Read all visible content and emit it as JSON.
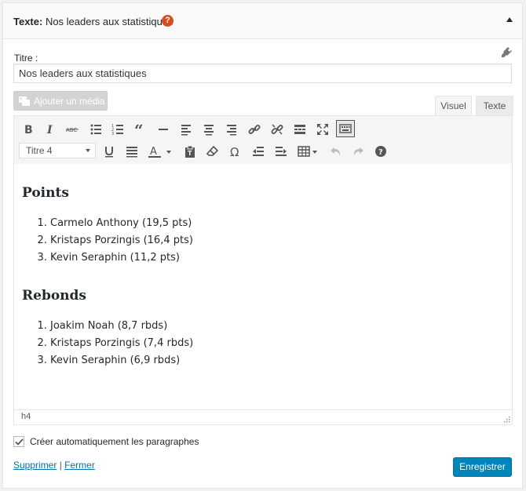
{
  "widget": {
    "title_prefix": "Texte:",
    "title_value": " Nos leaders aux statistiques",
    "help_label": "?"
  },
  "form": {
    "title_label": "Titre :",
    "title_value": "Nos leaders aux statistiques"
  },
  "editor": {
    "media_button_label": "Ajouter un média",
    "tabs": [
      {
        "label": "Visuel",
        "active": true
      },
      {
        "label": "Texte",
        "active": false
      }
    ],
    "toolbar_row1": [
      "bold-icon",
      "italic-icon",
      "strikethrough-icon",
      "bullet-list-icon",
      "numbered-list-icon",
      "blockquote-icon",
      "horizontal-rule-icon",
      "align-left-icon",
      "align-center-icon",
      "align-right-icon",
      "link-icon",
      "unlink-icon",
      "read-more-icon",
      "fullscreen-icon",
      "toolbar-toggle-icon"
    ],
    "format_select_value": "Titre 4",
    "toolbar_row2": [
      "underline-icon",
      "justify-icon",
      "text-color-icon",
      "paste-text-icon",
      "clear-formatting-icon",
      "special-char-icon",
      "outdent-icon",
      "indent-icon",
      "table-icon",
      "undo-icon",
      "redo-icon",
      "help-icon"
    ],
    "content": {
      "heading1": "Points",
      "list1": [
        "Carmelo Anthony (19,5 pts)",
        "Kristaps Porzingis (16,4 pts)",
        "Kevin Seraphin (11,2 pts)"
      ],
      "heading2": "Rebonds",
      "list2": [
        "Joakim Noah (8,7 rbds)",
        "Kristaps Porzingis (7,4 rbds)",
        "Kevin Seraphin (6,9 rbds)"
      ]
    },
    "status_path": "h4"
  },
  "options": {
    "auto_paragraph_label": "Créer automatiquement les paragraphes",
    "auto_paragraph_checked": true
  },
  "actions": {
    "delete_label": "Supprimer",
    "separator": "|",
    "close_label": "Fermer",
    "save_label": "Enregistrer"
  },
  "colors": {
    "accent": "#0085ba",
    "help_badge": "#d54e21",
    "link": "#0073aa"
  }
}
